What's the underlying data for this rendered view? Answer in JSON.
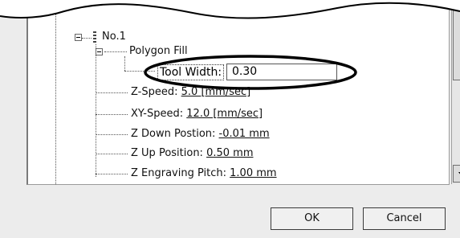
{
  "tree": {
    "node_root": "No.1",
    "node_polygon": "Polygon Fill",
    "tool_width_label": "Tool Width:",
    "tool_width_value": "0.30",
    "z_speed": {
      "label": "Z-Speed:",
      "value": "5.0 [mm/sec]"
    },
    "xy_speed": {
      "label": "XY-Speed:",
      "value": "12.0 [mm/sec]"
    },
    "z_down": {
      "label": "Z Down Postion:",
      "value": "-0.01 mm"
    },
    "z_up": {
      "label": "Z Up Position:",
      "value": "0.50 mm"
    },
    "z_pitch": {
      "label": "Z Engraving Pitch:",
      "value": "1.00 mm"
    }
  },
  "buttons": {
    "ok": "OK",
    "cancel": "Cancel"
  },
  "annotation": {
    "highlight": "oval around Tool Width field"
  }
}
